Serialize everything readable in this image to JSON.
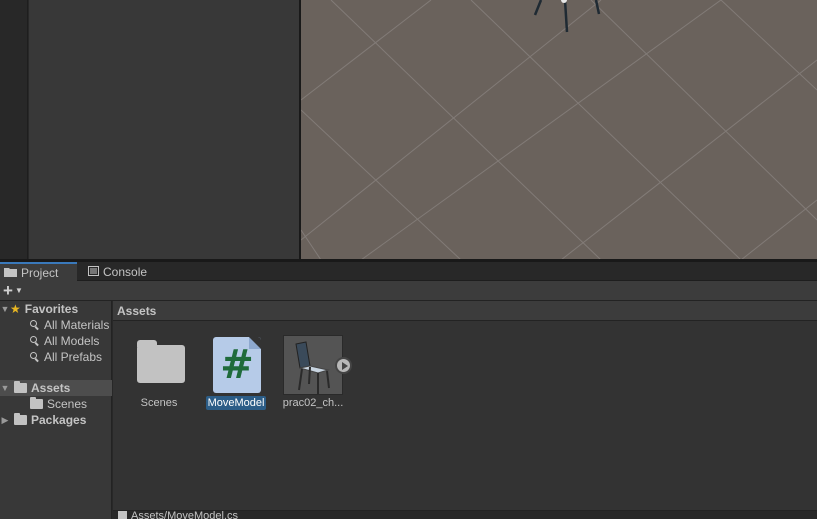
{
  "tabs": [
    {
      "label": "Project",
      "icon": "folder-icon",
      "active": true
    },
    {
      "label": "Console",
      "icon": "console-icon",
      "active": false
    }
  ],
  "toolbar": {
    "add_label": "+"
  },
  "tree": {
    "favorites": {
      "label": "Favorites",
      "items": [
        "All Materials",
        "All Models",
        "All Prefabs"
      ]
    },
    "assets": {
      "label": "Assets",
      "children": [
        "Scenes"
      ]
    },
    "packages": {
      "label": "Packages"
    }
  },
  "assets_header": "Assets",
  "asset_items": [
    {
      "label": "Scenes",
      "type": "folder",
      "selected": false
    },
    {
      "label": "MoveModel",
      "type": "script",
      "selected": true
    },
    {
      "label": "prac02_ch...",
      "type": "model",
      "selected": false
    }
  ],
  "status": {
    "path": "Assets/MoveModel.cs"
  },
  "colors": {
    "scene_bg": "#6a625c",
    "selection": "#2c5d87",
    "script_icon": "#b6cbe8",
    "script_hash": "#1f6b3b",
    "favorites_star": "#e9b722"
  }
}
